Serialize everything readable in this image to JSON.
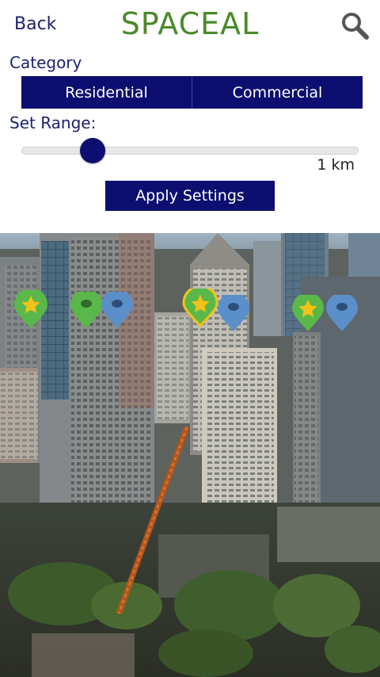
{
  "header": {
    "back_label": "Back",
    "title": "SPACEAL"
  },
  "filters": {
    "category_label": "Category",
    "categories": [
      "Residential",
      "Commercial"
    ],
    "range_label": "Set Range:",
    "range_value": "1 km",
    "range_fraction": 0.21,
    "apply_label": "Apply Settings"
  },
  "colors": {
    "brand_green": "#4a8a2a",
    "navy": "#0c0f6f",
    "pin_green": "#5ab84a",
    "pin_blue": "#5b8fc9",
    "star_yellow": "#f2c21a"
  },
  "markers": [
    {
      "kind": "green-star"
    },
    {
      "kind": "green"
    },
    {
      "kind": "blue"
    },
    {
      "kind": "green-star-selected"
    },
    {
      "kind": "blue"
    },
    {
      "kind": "green-star"
    },
    {
      "kind": "blue"
    }
  ]
}
